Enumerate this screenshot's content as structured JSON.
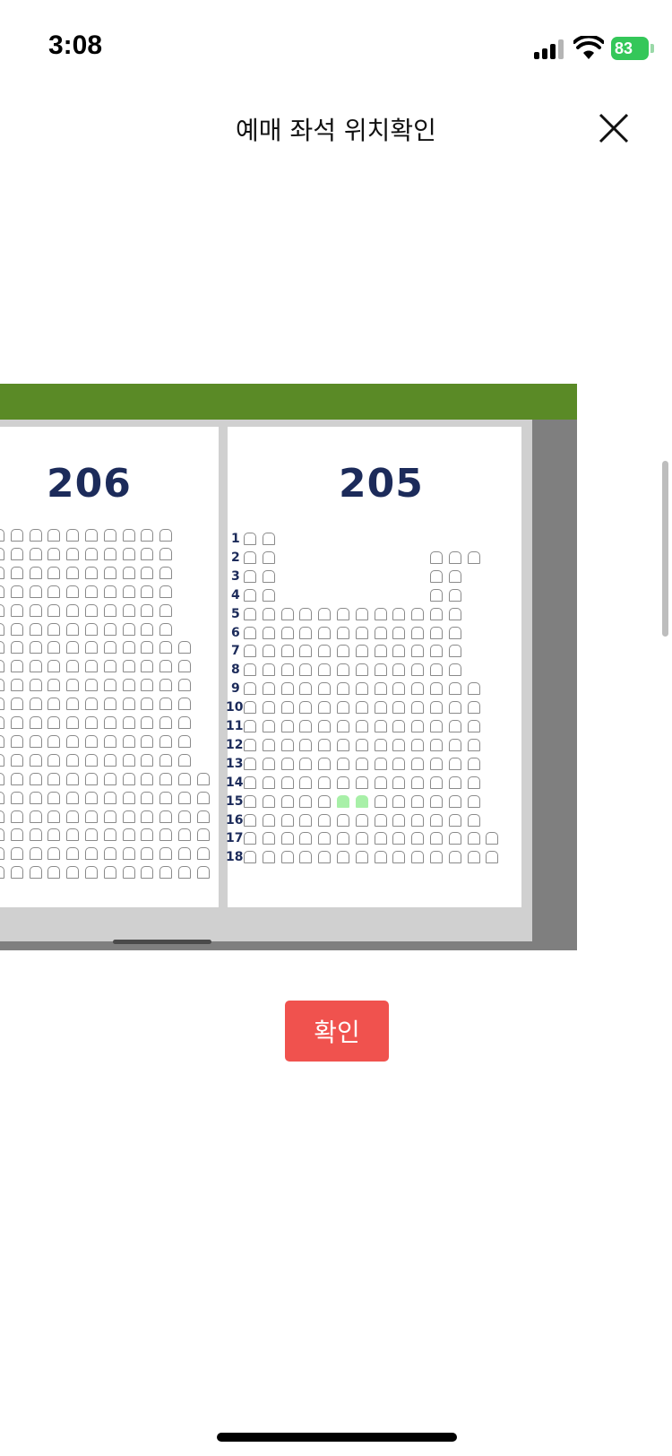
{
  "status_bar": {
    "time": "3:08",
    "battery": "83"
  },
  "header": {
    "title": "예매 좌석 위치확인",
    "close_icon": "close-icon"
  },
  "seat_map": {
    "header_color": "#5a8a26",
    "sections": [
      {
        "label": "206"
      },
      {
        "label": "205"
      }
    ],
    "rows_205": [
      "1",
      "2",
      "3",
      "4",
      "5",
      "6",
      "7",
      "8",
      "9",
      "10",
      "11",
      "12",
      "13",
      "14",
      "15",
      "16",
      "17",
      "18"
    ],
    "selected_seats": [
      {
        "section": "205",
        "row": "15",
        "seat_index": 5
      },
      {
        "section": "205",
        "row": "15",
        "seat_index": 6
      }
    ],
    "selected_color": "#a8f0a8"
  },
  "confirm_button": {
    "label": "확인",
    "color": "#f0524e"
  }
}
